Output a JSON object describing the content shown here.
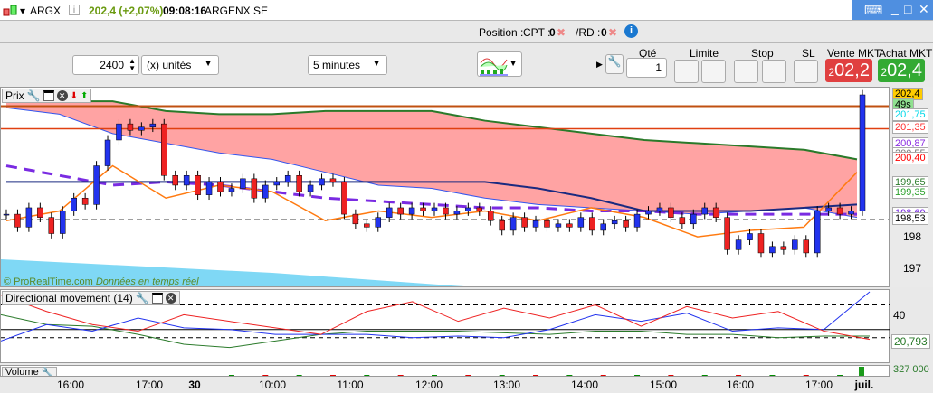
{
  "title": {
    "symbol": "ARGX",
    "price": "202,4 (+2,07%)",
    "time": "09:08:16",
    "name": "ARGENX SE"
  },
  "position": {
    "label": "Position :",
    "cpt": "CPT :",
    "cpt_val": "0",
    "rd": "/RD :",
    "rd_val": "0"
  },
  "toolbar": {
    "quantity": "2400",
    "units": "(x) unités",
    "timeframe": "5 minutes"
  },
  "order": {
    "qty_label": "Qté",
    "qty": "1",
    "limit_label": "Limite",
    "stop_label": "Stop",
    "sl_label": "SL",
    "sell_label": "Vente MKT",
    "buy_label": "Achat MKT",
    "sell_small": "2",
    "sell_price": "02,2",
    "buy_small": "2",
    "buy_price": "02,4",
    "sell_color": "#e04040",
    "buy_color": "#33aa33"
  },
  "price_panel": {
    "title": "Prix",
    "watermark_brand": "© ProRealTime.com",
    "watermark_text": "Données en temps réel"
  },
  "price_axis": {
    "ticks": [
      "198",
      "197"
    ],
    "tags": [
      {
        "v": 202.4,
        "t": "202,4",
        "bg": "#ffcc00",
        "fg": "#000"
      },
      {
        "v": 202.05,
        "t": "49s",
        "bg": "#90e090",
        "fg": "#000"
      },
      {
        "v": 201.75,
        "t": "201,75",
        "bg": "#fff",
        "fg": "#00d8e8"
      },
      {
        "v": 201.35,
        "t": "201,35",
        "bg": "#fff",
        "fg": "#ff3030"
      },
      {
        "v": 200.87,
        "t": "200,87",
        "bg": "#fff",
        "fg": "#8a2be2"
      },
      {
        "v": 200.55,
        "t": "200,55",
        "bg": "#fff",
        "fg": "#777"
      },
      {
        "v": 200.4,
        "t": "200,40",
        "bg": "#fff",
        "fg": "#ff0000"
      },
      {
        "v": 199.65,
        "t": "199,65",
        "bg": "#fff",
        "fg": "#2a7a2a"
      },
      {
        "v": 199.35,
        "t": "199,35",
        "bg": "#fff",
        "fg": "#2aa02a"
      },
      {
        "v": 198.69,
        "t": "198,69",
        "bg": "#fff",
        "fg": "#7a2be2"
      },
      {
        "v": 198.53,
        "t": "198,53",
        "bg": "#fff",
        "fg": "#000"
      }
    ]
  },
  "chart_data": {
    "type": "candlestick",
    "closes": [
      198.7,
      198.3,
      198.9,
      198.6,
      198.1,
      198.8,
      199.2,
      199.0,
      200.2,
      201.0,
      201.5,
      201.3,
      201.4,
      201.5,
      199.9,
      199.6,
      199.9,
      199.3,
      199.7,
      199.4,
      199.5,
      199.8,
      199.2,
      199.6,
      199.7,
      199.9,
      199.4,
      199.6,
      199.8,
      199.7,
      198.7,
      198.4,
      198.3,
      198.6,
      198.9,
      198.7,
      198.9,
      198.8,
      198.9,
      198.7,
      198.8,
      198.9,
      198.8,
      198.5,
      198.2,
      198.6,
      198.3,
      198.5,
      198.3,
      198.4,
      198.3,
      198.6,
      198.2,
      198.4,
      198.5,
      198.3,
      198.7,
      198.8,
      198.9,
      198.6,
      198.4,
      198.7,
      198.9,
      198.6,
      197.6,
      197.9,
      198.1,
      197.5,
      197.7,
      197.6,
      197.9,
      197.5,
      198.8,
      198.9,
      198.7,
      198.8,
      202.4
    ],
    "ichimoku_a": [
      202.0,
      201.8,
      201.2,
      200.9,
      200.6,
      200.4,
      200.0,
      199.6,
      199.5,
      199.2,
      199.0,
      198.9,
      198.8,
      198.7,
      198.8,
      198.9,
      198.6
    ],
    "ichimoku_b": [
      202.2,
      202.2,
      202.2,
      201.9,
      201.8,
      201.8,
      201.9,
      201.9,
      201.9,
      201.6,
      201.4,
      201.2,
      201.0,
      200.9,
      200.8,
      200.7,
      200.4
    ],
    "kijun": [
      199.7,
      199.7,
      199.7,
      199.7,
      199.7,
      199.7,
      199.7,
      199.7,
      199.7,
      199.7,
      199.5,
      199.2,
      198.8,
      198.8,
      198.8,
      198.9,
      199.0
    ],
    "tenkan": [
      198.5,
      198.8,
      200.2,
      199.2,
      199.6,
      199.4,
      198.5,
      198.8,
      198.6,
      198.8,
      198.5,
      198.9,
      198.6,
      198.0,
      198.2,
      198.3,
      200.0
    ],
    "ma_dashed": [
      200.2,
      199.9,
      199.6,
      199.7,
      199.6,
      199.4,
      199.2,
      199.1,
      199.0,
      198.9,
      198.9,
      198.8,
      198.8,
      198.7,
      198.7,
      198.7,
      198.7
    ],
    "dmi": {
      "ylim": [
        5,
        48
      ],
      "levels": [
        40,
        25,
        20
      ],
      "adx": [
        34,
        28,
        27,
        22,
        16,
        14,
        18,
        22,
        24,
        24,
        24,
        23,
        22,
        24,
        24,
        22,
        22,
        20,
        21,
        21
      ],
      "di_plus": [
        18,
        28,
        24,
        32,
        26,
        25,
        22,
        22,
        22,
        20,
        21,
        20,
        25,
        34,
        30,
        35,
        24,
        26,
        25,
        48
      ],
      "di_minus": [
        46,
        36,
        28,
        24,
        34,
        30,
        26,
        22,
        36,
        42,
        30,
        38,
        32,
        40,
        27,
        39,
        32,
        36,
        24,
        19
      ],
      "readout": "20,793",
      "ticks": [
        "40"
      ]
    },
    "volume": {
      "readout": "327 000"
    },
    "xticks": [
      "16:00",
      "17:00",
      "30",
      "10:00",
      "11:00",
      "12:00",
      "13:00",
      "14:00",
      "15:00",
      "16:00",
      "17:00",
      "juil."
    ]
  },
  "dmi_panel": {
    "title": "Directional movement (14)"
  },
  "volume_panel": {
    "title": "Volume"
  }
}
